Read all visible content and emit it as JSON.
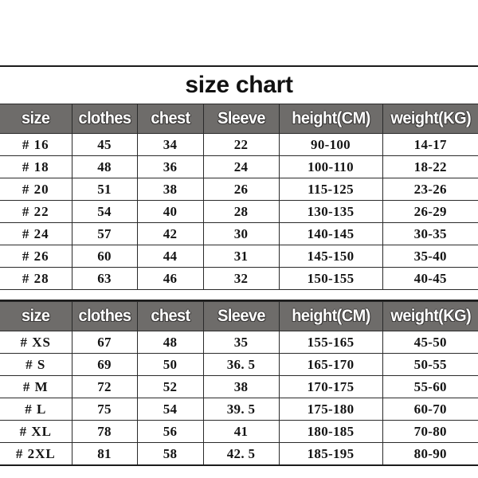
{
  "chart": {
    "title": "size chart",
    "columns": [
      "size",
      "clothes",
      "chest",
      "Sleeve",
      "height(CM)",
      "weight(KG)"
    ],
    "tables": [
      {
        "name": "kids-sizes",
        "headers": [
          "size",
          "clothes",
          "chest",
          "Sleeve",
          "height(CM)",
          "weight(KG)"
        ],
        "rows": [
          [
            "# 16",
            "45",
            "34",
            "22",
            "90-100",
            "14-17"
          ],
          [
            "# 18",
            "48",
            "36",
            "24",
            "100-110",
            "18-22"
          ],
          [
            "# 20",
            "51",
            "38",
            "26",
            "115-125",
            "23-26"
          ],
          [
            "# 22",
            "54",
            "40",
            "28",
            "130-135",
            "26-29"
          ],
          [
            "# 24",
            "57",
            "42",
            "30",
            "140-145",
            "30-35"
          ],
          [
            "# 26",
            "60",
            "44",
            "31",
            "145-150",
            "35-40"
          ],
          [
            "# 28",
            "63",
            "46",
            "32",
            "150-155",
            "40-45"
          ]
        ]
      },
      {
        "name": "adult-sizes",
        "headers": [
          "size",
          "clothes",
          "chest",
          "Sleeve",
          "height(CM)",
          "weight(KG)"
        ],
        "rows": [
          [
            "# XS",
            "67",
            "48",
            "35",
            "155-165",
            "45-50"
          ],
          [
            "# S",
            "69",
            "50",
            "36. 5",
            "165-170",
            "50-55"
          ],
          [
            "# M",
            "72",
            "52",
            "38",
            "170-175",
            "55-60"
          ],
          [
            "# L",
            "75",
            "54",
            "39. 5",
            "175-180",
            "60-70"
          ],
          [
            "# XL",
            "78",
            "56",
            "41",
            "180-185",
            "70-80"
          ],
          [
            "# 2XL",
            "81",
            "58",
            "42. 5",
            "185-195",
            "80-90"
          ]
        ]
      }
    ],
    "colors": {
      "header_background": "#6e6c6a",
      "header_text": "#ffffff",
      "border": "#232323",
      "page_background": "#ffffff",
      "body_text": "#141414"
    }
  }
}
